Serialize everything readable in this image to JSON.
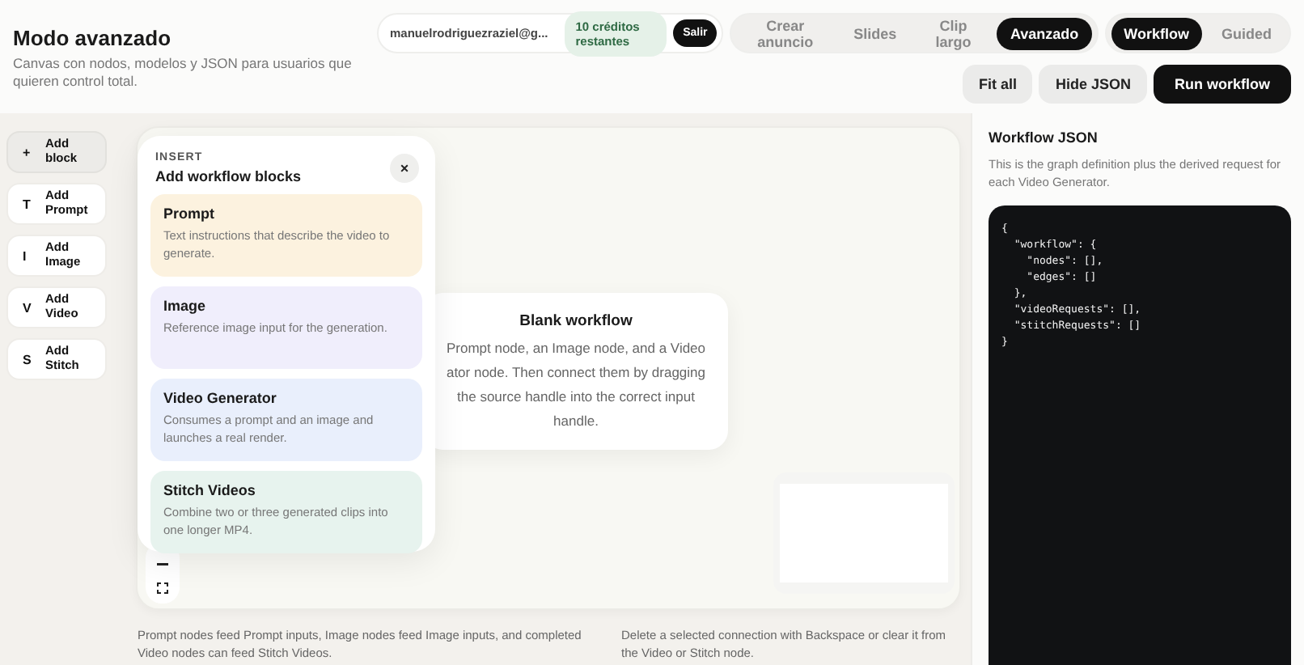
{
  "header": {
    "title": "Modo avanzado",
    "subtitle": "Canvas con nodos, modelos y JSON para usuarios que quieren control total.",
    "account": {
      "email": "manuelrodriguezraziel@g...",
      "credits": "10 créditos restantes",
      "logout": "Salir"
    },
    "nav": [
      {
        "label": "Crear anuncio",
        "selected": false
      },
      {
        "label": "Slides",
        "selected": false
      },
      {
        "label": "Clip largo",
        "selected": false
      },
      {
        "label": "Avanzado",
        "selected": true
      }
    ],
    "modes": [
      {
        "label": "Workflow",
        "selected": true
      },
      {
        "label": "Guided",
        "selected": false
      }
    ],
    "actions": [
      {
        "label": "Fit all",
        "kind": "secondary"
      },
      {
        "label": "Hide JSON",
        "kind": "secondary"
      },
      {
        "label": "Run workflow",
        "kind": "primary"
      }
    ]
  },
  "sidebar": {
    "items": [
      {
        "glyph": "+",
        "label": "Add block",
        "selected": true
      },
      {
        "glyph": "T",
        "label": "Add Prompt",
        "selected": false
      },
      {
        "glyph": "I",
        "label": "Add Image",
        "selected": false
      },
      {
        "glyph": "V",
        "label": "Add Video",
        "selected": false
      },
      {
        "glyph": "S",
        "label": "Add Stitch",
        "selected": false
      }
    ]
  },
  "insert_panel": {
    "eyebrow": "INSERT",
    "title": "Add workflow blocks",
    "close": "×",
    "blocks": [
      {
        "title": "Prompt",
        "description": "Text instructions that describe the video to generate.",
        "color": "#fcf2df"
      },
      {
        "title": "Image",
        "description": "Reference image input for the generation.",
        "color": "#f0eefc"
      },
      {
        "title": "Video Generator",
        "description": "Consumes a prompt and an image and launches a real render.",
        "color": "#e9effc"
      },
      {
        "title": "Stitch Videos",
        "description": "Combine two or three generated clips into one longer MP4.",
        "color": "#e7f3ee"
      }
    ]
  },
  "canvas": {
    "empty_card": {
      "title": "Blank workflow",
      "lines": [
        "Prompt node, an Image node, and a Video",
        "ator node. Then connect them by dragging",
        "the source handle into the correct input",
        "handle."
      ]
    }
  },
  "notes": [
    "Prompt nodes feed Prompt inputs, Image nodes feed Image inputs, and completed Video nodes can feed Stitch Videos.",
    "Delete a selected connection with Backspace or clear it from the Video or Stitch node."
  ],
  "json_panel": {
    "title": "Workflow JSON",
    "description": "This is the graph definition plus the derived request for each Video Generator.",
    "code": "{\n  \"workflow\": {\n    \"nodes\": [],\n    \"edges\": []\n  },\n  \"videoRequests\": [],\n  \"stitchRequests\": []\n}"
  }
}
